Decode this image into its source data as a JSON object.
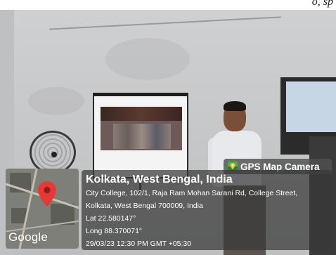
{
  "caption": {
    "visible_text": "o, sp"
  },
  "badge": {
    "label": "GPS Map Camera",
    "icon": "gps-map-camera-icon"
  },
  "map": {
    "watermark": "Google",
    "pin_icon": "location-pin-icon",
    "pin_color": "#e53935"
  },
  "location": {
    "city": "Kolkata, West Bengal, India",
    "address_line1": "City College, 102/1, Raja Ram Mohan Sarani Rd, College Street,",
    "address_line2": "Kolkata, West Bengal 700009, India",
    "lat": "Lat 22.580147°",
    "long": "Long 88.370071°",
    "timestamp": "29/03/23 12:30 PM GMT +05:30"
  }
}
